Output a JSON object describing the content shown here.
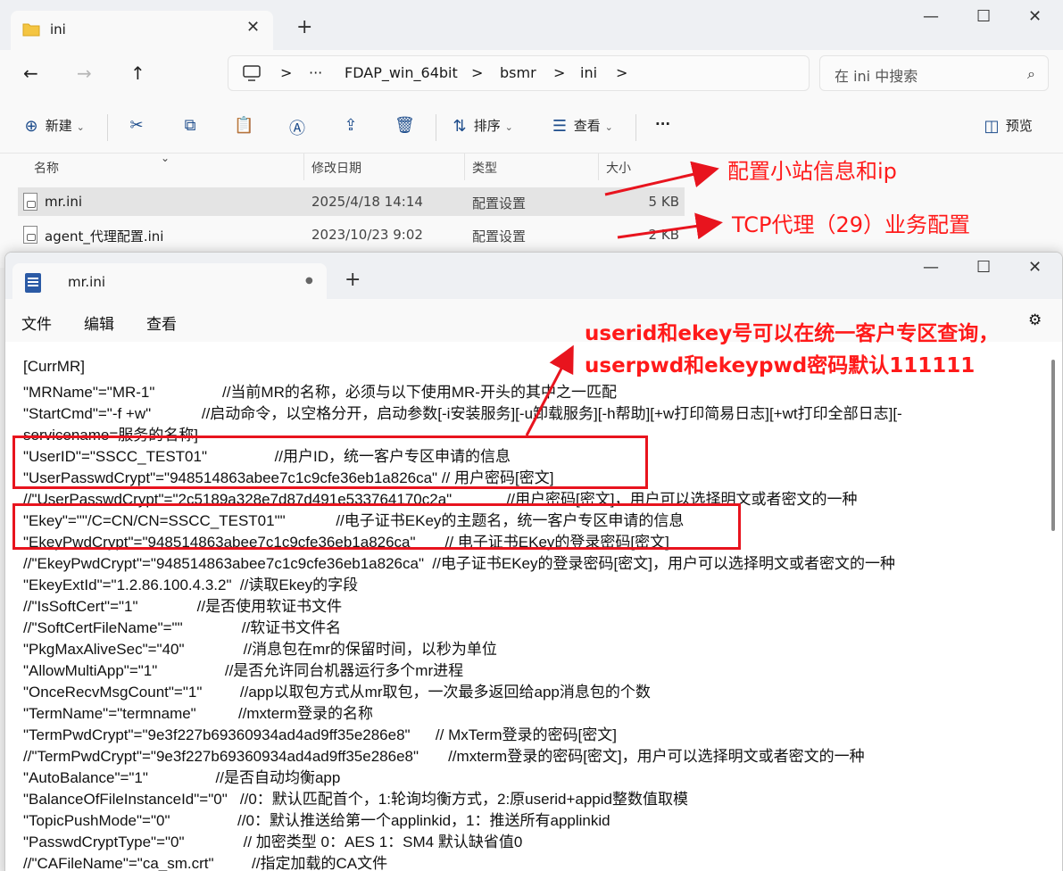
{
  "explorer": {
    "tab_title": "ini",
    "tab_close": "✕",
    "new_tab": "+",
    "window": {
      "minimize": "—",
      "maximize": "☐",
      "close": "✕"
    },
    "nav": {
      "back": "←",
      "forward": "→",
      "up": "↑"
    },
    "address": {
      "more": "···",
      "crumbs": [
        "FDAP_win_64bit",
        "bsmr",
        "ini"
      ],
      "sep": ">"
    },
    "search": {
      "placeholder": "在 ini 中搜索",
      "icon": "⌕"
    },
    "toolbar": {
      "new_label": "新建",
      "sort_label": "排序",
      "view_label": "查看",
      "more": "···",
      "preview_label": "预览"
    },
    "columns": {
      "name": "名称",
      "modified": "修改日期",
      "type": "类型",
      "size": "大小"
    },
    "files": [
      {
        "name": "mr.ini",
        "modified": "2025/4/18 14:14",
        "type": "配置设置",
        "size": "5 KB"
      },
      {
        "name": "agent_代理配置.ini",
        "modified": "2023/10/23 9:02",
        "type": "配置设置",
        "size": "2 KB"
      }
    ]
  },
  "notepad": {
    "tab_title": "mr.ini",
    "tab_dot": "●",
    "new_tab": "+",
    "window": {
      "minimize": "—",
      "maximize": "☐",
      "close": "✕"
    },
    "menu": {
      "file": "文件",
      "edit": "编辑",
      "view": "查看"
    },
    "settings_icon": "⚙",
    "lines": [
      "[CurrMR]",
      "\"MRName\"=\"MR-1\"                //当前MR的名称，必须与以下使用MR-开头的其中之一匹配",
      "\"StartCmd\"=\"-f +w\"            //启动命令，以空格分开，启动参数[-i安装服务][-u卸载服务][-h帮助][+w打印简易日志][+wt打印全部日志][-",
      "servicename=服务的名称]",
      "\"UserID\"=\"SSCC_TEST01\"                //用户ID，统一客户专区申请的信息",
      "\"UserPasswdCrypt\"=\"948514863abee7c1c9cfe36eb1a826ca\" // 用户密码[密文]",
      "//\"UserPasswdCrypt\"=\"2c5189a328e7d87d491e533764170c2a\"             //用户密码[密文]，用户可以选择明文或者密文的一种",
      "\"Ekey\"=\"\"/C=CN/CN=SSCC_TEST01\"\"            //电子证书EKey的主题名，统一客户专区申请的信息",
      "\"EkeyPwdCrypt\"=\"948514863abee7c1c9cfe36eb1a826ca\"       // 电子证书EKey的登录密码[密文]",
      "//\"EkeyPwdCrypt\"=\"948514863abee7c1c9cfe36eb1a826ca\"  //电子证书EKey的登录密码[密文]，用户可以选择明文或者密文的一种",
      "\"EkeyExtId\"=\"1.2.86.100.4.3.2\"  //读取Ekey的字段",
      "//\"IsSoftCert\"=\"1\"              //是否使用软证书文件",
      "//\"SoftCertFileName\"=\"\"              //软证书文件名",
      "\"PkgMaxAliveSec\"=\"40\"              //消息包在mr的保留时间，以秒为单位",
      "\"AllowMultiApp\"=\"1\"                //是否允许同台机器运行多个mr进程",
      "\"OnceRecvMsgCount\"=\"1\"         //app以取包方式从mr取包，一次最多返回给app消息包的个数",
      "\"TermName\"=\"termname\"          //mxterm登录的名称",
      "\"TermPwdCrypt\"=\"9e3f227b69360934ad4ad9ff35e286e8\"      // MxTerm登录的密码[密文]",
      "//\"TermPwdCrypt\"=\"9e3f227b69360934ad4ad9ff35e286e8\"       //mxterm登录的密码[密文]，用户可以选择明文或者密文的一种",
      "\"AutoBalance\"=\"1\"                //是否自动均衡app",
      "\"BalanceOfFileInstanceId\"=\"0\"   //0：默认匹配首个，1:轮询均衡方式，2:原userid+appid整数值取模",
      "\"TopicPushMode\"=\"0\"                //0：默认推送给第一个applinkid，1：推送所有applinkid",
      "\"PasswdCryptType\"=\"0\"              // 加密类型 0：AES 1：SM4 默认缺省值0",
      "//\"CAFileName\"=\"ca_sm.crt\"         //指定加载的CA文件"
    ]
  },
  "annotations": {
    "station": "配置小站信息和ip",
    "tcp": "TCP代理（29）业务配置",
    "userid_line1": "userid和ekey号可以在统一客户专区查询，",
    "userid_line2": "userpwd和ekeypwd密码默认111111"
  },
  "colors": {
    "annotation_red": "#ff1a1a",
    "box_red": "#e8141e",
    "selection": "#e4e4e4",
    "accent": "#1e4d8c"
  }
}
